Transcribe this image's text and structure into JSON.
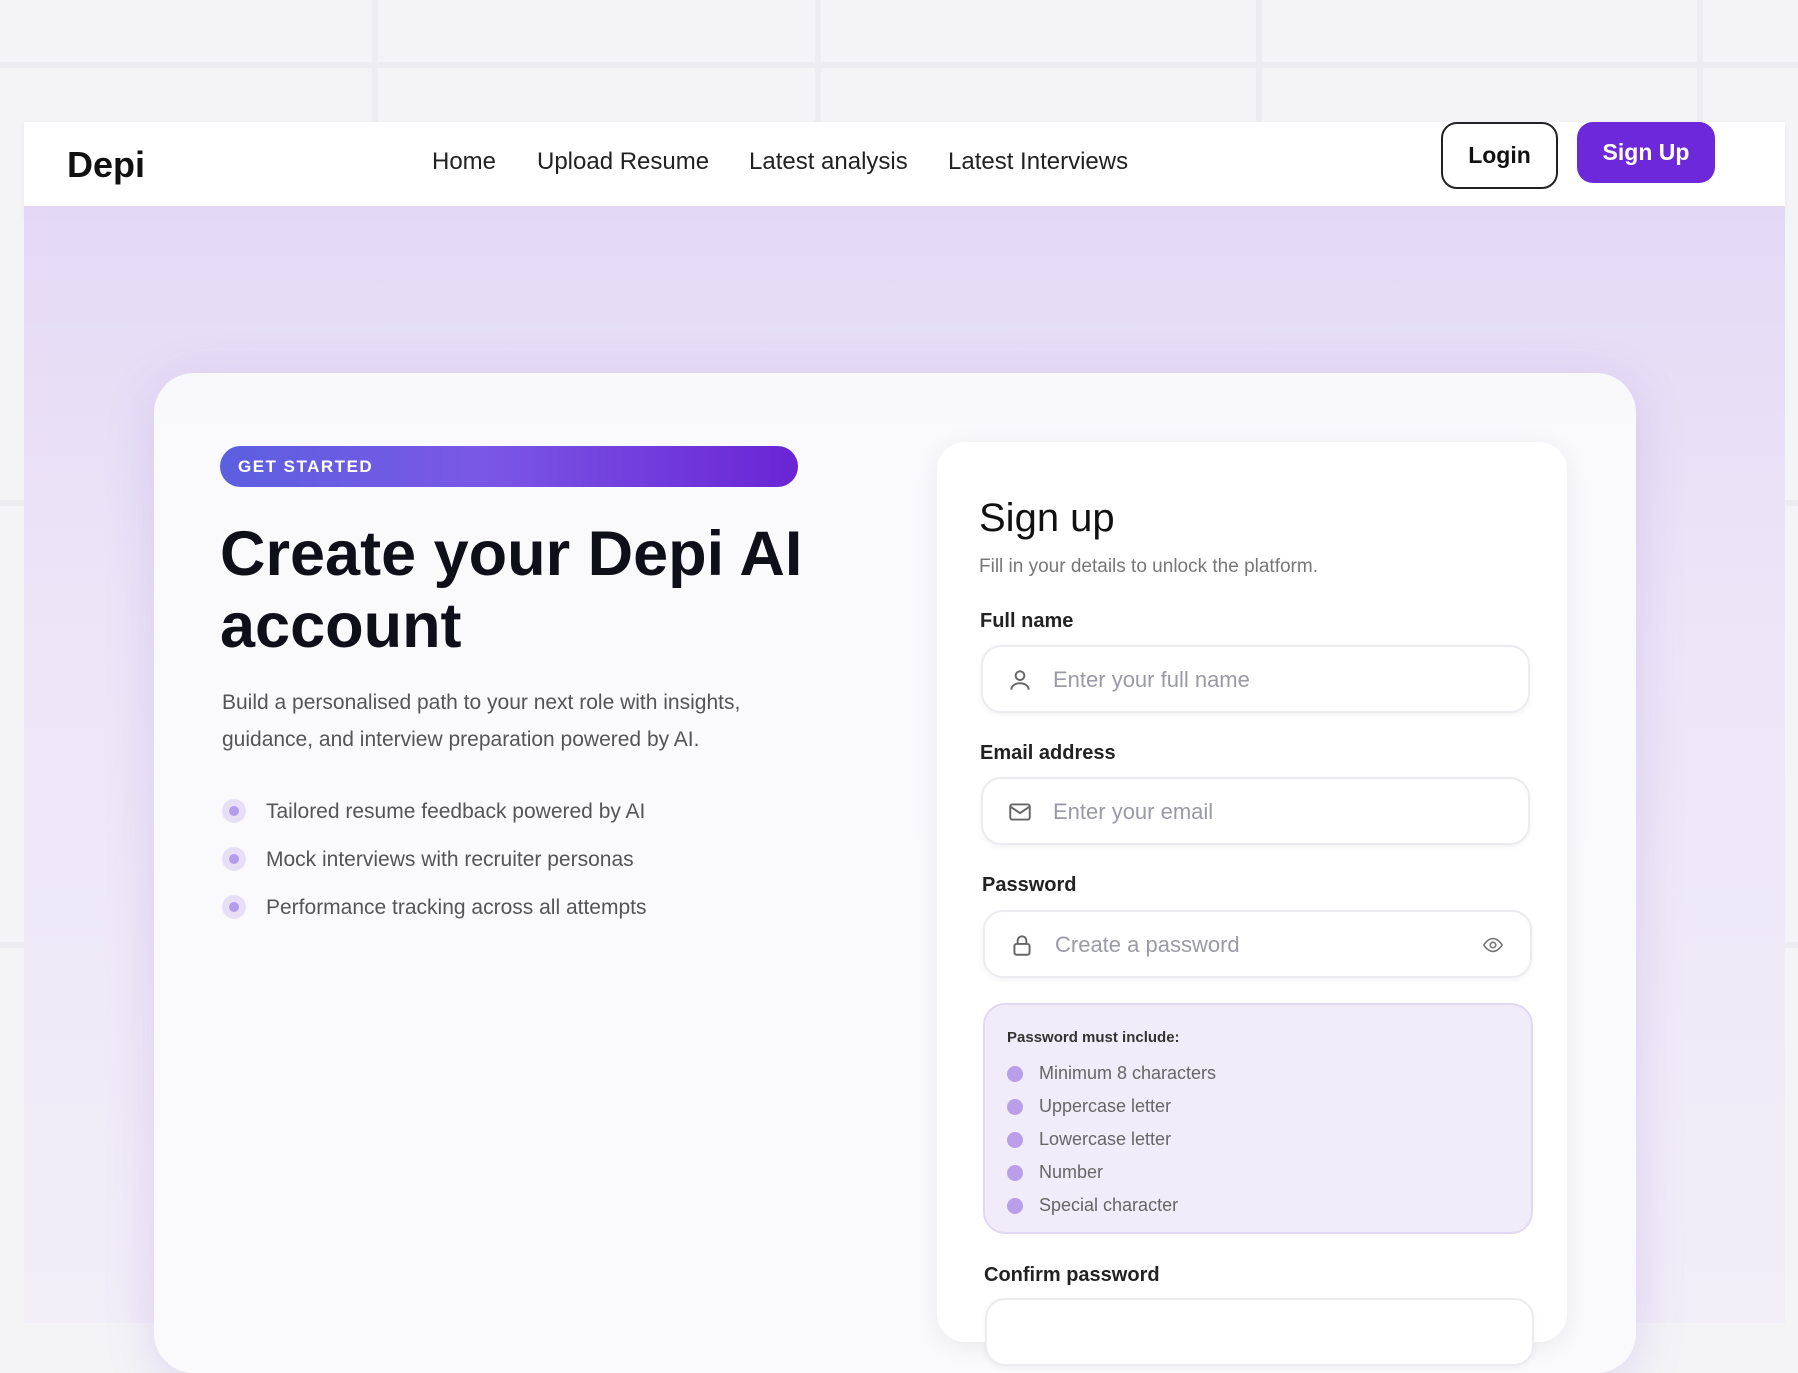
{
  "navbar": {
    "brand": "Depi",
    "links": [
      "Home",
      "Upload Resume",
      "Latest analysis",
      "Latest Interviews"
    ],
    "login_label": "Login",
    "signup_label": "Sign Up"
  },
  "hero": {
    "badge": "GET STARTED",
    "headline": "Create your Depi AI account",
    "description": "Build a personalised path to your next role with insights, guidance, and interview preparation powered by AI.",
    "features": [
      "Tailored resume feedback powered by AI",
      "Mock interviews with recruiter personas",
      "Performance tracking across all attempts"
    ]
  },
  "form": {
    "title": "Sign up",
    "subtitle": "Fill in your details to unlock the platform.",
    "fullname": {
      "label": "Full name",
      "placeholder": "Enter your full name",
      "icon": "user-icon"
    },
    "email": {
      "label": "Email address",
      "placeholder": "Enter your email",
      "icon": "mail-icon"
    },
    "password": {
      "label": "Password",
      "placeholder": "Create a password",
      "icon": "lock-icon"
    },
    "rules_title": "Password must include:",
    "rules": [
      "Minimum 8 characters",
      "Uppercase letter",
      "Lowercase letter",
      "Number",
      "Special character"
    ],
    "confirm_label": "Confirm password"
  },
  "colors": {
    "accent": "#6d28d9",
    "accent_light": "#b99eea",
    "hero_bg": "#e4d9f5"
  }
}
